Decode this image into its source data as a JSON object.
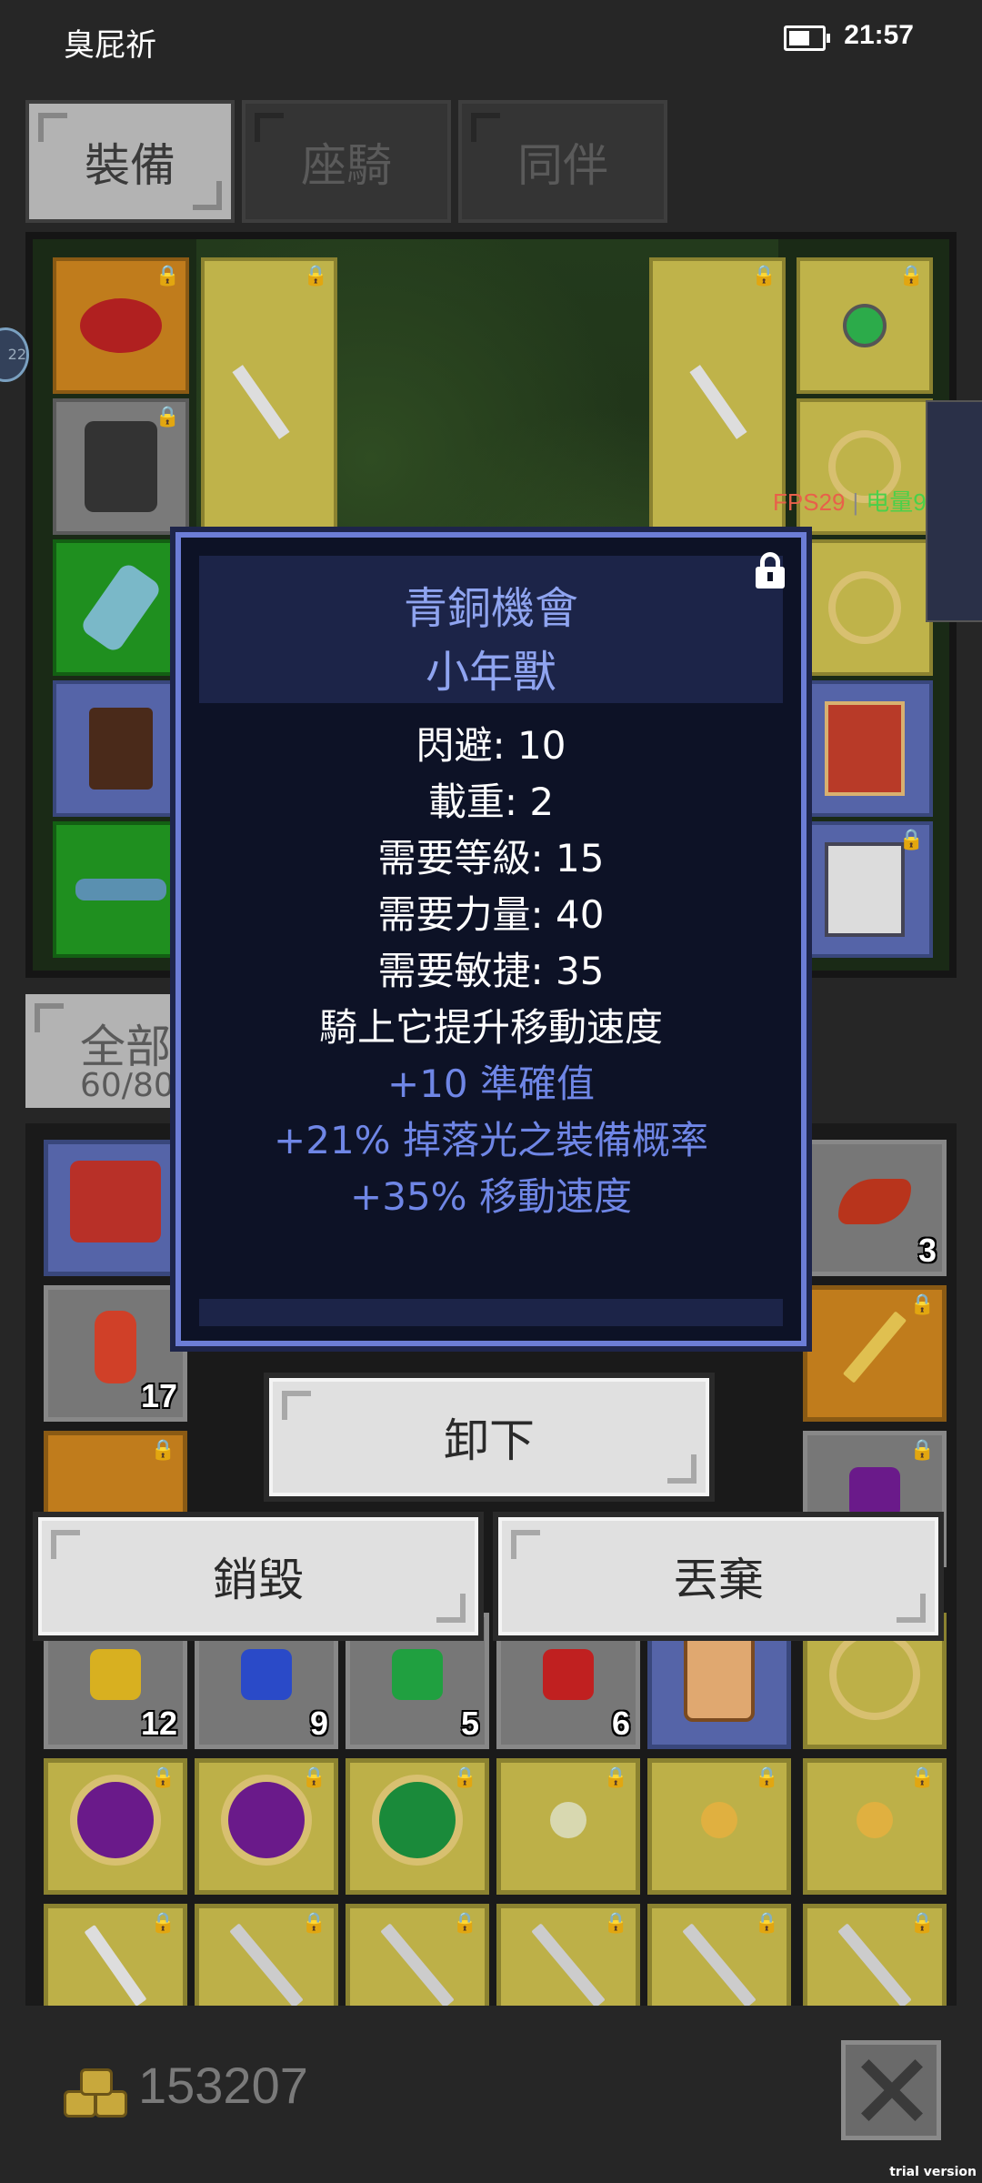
{
  "status_bar": {
    "name": "臭屁祈",
    "time": "21:57"
  },
  "tabs": [
    {
      "label": "裝備",
      "active": true
    },
    {
      "label": "座騎",
      "active": false
    },
    {
      "label": "同伴",
      "active": false
    }
  ],
  "overlay": {
    "fps": "FPS29",
    "power": "电量9",
    "side_badge": "22"
  },
  "inventory": {
    "filter_label": "全部",
    "capacity": "60/80",
    "counts": [
      "3",
      "17",
      "12",
      "9",
      "5",
      "6"
    ]
  },
  "tooltip": {
    "title": "青銅機會",
    "subtitle": "小年獸",
    "stats": [
      "閃避: 10",
      "載重: 2",
      "需要等級: 15",
      "需要力量: 40",
      "需要敏捷: 35",
      "騎上它提升移動速度"
    ],
    "bonuses": [
      "+10 準確值",
      "+21% 掉落光之裝備概率",
      "+35% 移動速度"
    ]
  },
  "actions": {
    "unequip": "卸下",
    "destroy": "銷毀",
    "discard": "丟棄"
  },
  "footer": {
    "gold": "153207"
  },
  "watermark": "trial version",
  "colors": {
    "tooltip_border": "#6c7dd6",
    "tooltip_title": "#8fa4f0",
    "bonus_text": "#6f86e6",
    "fps": "#e8604a",
    "power": "#4ad04a"
  }
}
